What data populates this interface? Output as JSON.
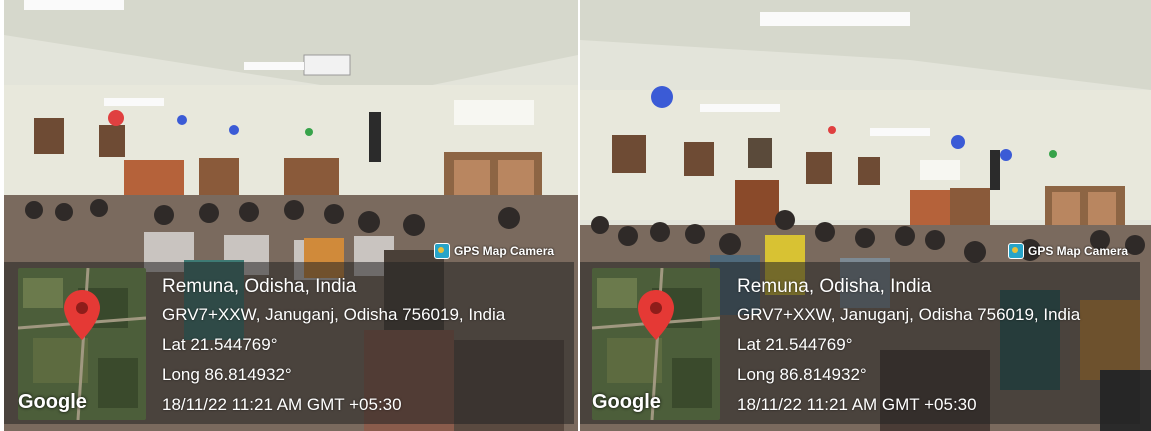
{
  "photos": [
    {
      "stamp": {
        "camera_label": "GPS Map Camera",
        "map_brand": "Google",
        "place": "Remuna, Odisha, India",
        "address": "GRV7+XXW, Januganj, Odisha 756019, India",
        "latitude": "Lat 21.544769°",
        "longitude": "Long 86.814932°",
        "datetime": "18/11/22 11:21 AM GMT +05:30"
      }
    },
    {
      "stamp": {
        "camera_label": "GPS Map Camera",
        "map_brand": "Google",
        "place": "Remuna, Odisha, India",
        "address": "GRV7+XXW, Januganj, Odisha 756019, India",
        "latitude": "Lat 21.544769°",
        "longitude": "Long 86.814932°",
        "datetime": "18/11/22 11:21 AM GMT +05:30"
      }
    }
  ],
  "colors": {
    "pin": "#e53935",
    "overlay": "#232323",
    "wall": "#e6e6dc",
    "camera_icon": "#27a4c9"
  },
  "icons": [
    "map-pin-icon",
    "gps-camera-icon"
  ]
}
